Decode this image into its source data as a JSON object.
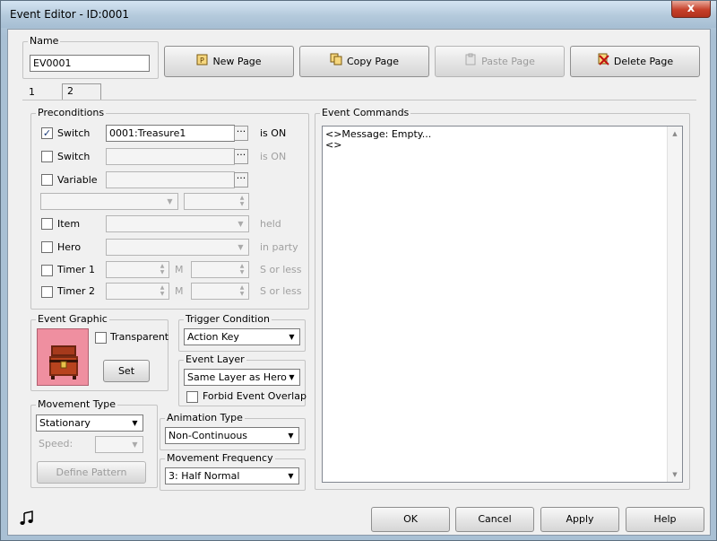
{
  "window": {
    "title": "Event Editor - ID:0001",
    "close_glyph": "x"
  },
  "name_group": {
    "label": "Name",
    "value": "EV0001"
  },
  "toolbar": {
    "new_page": "New Page",
    "copy_page": "Copy Page",
    "paste_page": "Paste Page",
    "delete_page": "Delete Page"
  },
  "tabs": [
    {
      "label": "1",
      "active": false
    },
    {
      "label": "2",
      "active": true
    }
  ],
  "preconditions": {
    "label": "Preconditions",
    "switch1": {
      "label": "Switch",
      "checked": true,
      "value": "0001:Treasure1",
      "suffix": "is ON"
    },
    "switch2": {
      "label": "Switch",
      "checked": false,
      "value": "",
      "suffix": "is ON"
    },
    "variable": {
      "label": "Variable",
      "checked": false,
      "value": ""
    },
    "item": {
      "label": "Item",
      "checked": false,
      "suffix": "held"
    },
    "hero": {
      "label": "Hero",
      "checked": false,
      "suffix": "in party"
    },
    "timer1": {
      "label": "Timer 1",
      "checked": false,
      "unit_m": "M",
      "unit_s": "S or less"
    },
    "timer2": {
      "label": "Timer 2",
      "checked": false,
      "unit_m": "M",
      "unit_s": "S or less"
    },
    "browse_glyph": "···"
  },
  "event_graphic": {
    "label": "Event Graphic",
    "transparent_label": "Transparent",
    "set_button": "Set"
  },
  "trigger": {
    "label": "Trigger Condition",
    "value": "Action Key"
  },
  "event_layer": {
    "label": "Event Layer",
    "value": "Same Layer as Hero",
    "forbid_overlap": "Forbid Event Overlap"
  },
  "movement_type": {
    "label": "Movement Type",
    "value": "Stationary",
    "speed_label": "Speed:",
    "define_pattern": "Define Pattern"
  },
  "animation_type": {
    "label": "Animation Type",
    "value": "Non-Continuous"
  },
  "movement_frequency": {
    "label": "Movement Frequency",
    "value": "3: Half Normal"
  },
  "event_commands": {
    "label": "Event Commands",
    "lines": [
      "<>Message: Empty...",
      "<>"
    ]
  },
  "footer": {
    "ok": "OK",
    "cancel": "Cancel",
    "apply": "Apply",
    "help": "Help"
  }
}
